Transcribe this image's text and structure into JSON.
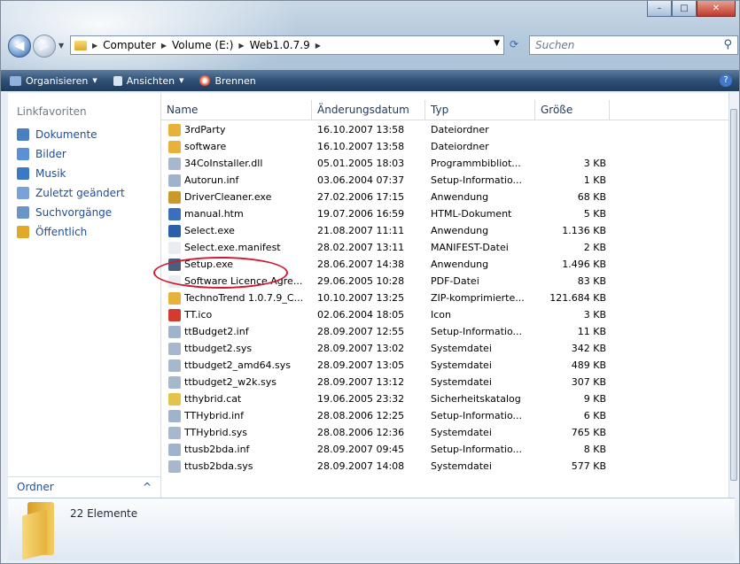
{
  "window": {
    "minimize": "–",
    "maximize": "□",
    "close": "✕"
  },
  "address": {
    "crumbs": [
      "Computer",
      "Volume (E:)",
      "Web1.0.7.9"
    ],
    "search_placeholder": "Suchen"
  },
  "toolbar": {
    "organize": "Organisieren",
    "views": "Ansichten",
    "burn": "Brennen"
  },
  "sidebar": {
    "heading": "Linkfavoriten",
    "items": [
      {
        "label": "Dokumente",
        "color": "#4a7fc1"
      },
      {
        "label": "Bilder",
        "color": "#5b8fd6"
      },
      {
        "label": "Musik",
        "color": "#3c78c4"
      },
      {
        "label": "Zuletzt geändert",
        "color": "#7aa2d9"
      },
      {
        "label": "Suchvorgänge",
        "color": "#6b95c7"
      },
      {
        "label": "Öffentlich",
        "color": "#e0a92a"
      }
    ],
    "folders_label": "Ordner",
    "folders_chevron": "^"
  },
  "columns": {
    "name": "Name",
    "date": "Änderungsdatum",
    "type": "Typ",
    "size": "Größe"
  },
  "files": [
    {
      "name": "3rdParty",
      "date": "16.10.2007 13:58",
      "type": "Dateiordner",
      "size": "",
      "color": "#e8b23a"
    },
    {
      "name": "software",
      "date": "16.10.2007 13:58",
      "type": "Dateiordner",
      "size": "",
      "color": "#e8b23a"
    },
    {
      "name": "34CoInstaller.dll",
      "date": "05.01.2005 18:03",
      "type": "Programmbibliot...",
      "size": "3 KB",
      "color": "#a7b8cc"
    },
    {
      "name": "Autorun.inf",
      "date": "03.06.2004 07:37",
      "type": "Setup-Informatio...",
      "size": "1 KB",
      "color": "#9fb4cc"
    },
    {
      "name": "DriverCleaner.exe",
      "date": "27.02.2006 17:15",
      "type": "Anwendung",
      "size": "68 KB",
      "color": "#c79a2a"
    },
    {
      "name": "manual.htm",
      "date": "19.07.2006 16:59",
      "type": "HTML-Dokument",
      "size": "5 KB",
      "color": "#3a6fc0"
    },
    {
      "name": "Select.exe",
      "date": "21.08.2007 11:11",
      "type": "Anwendung",
      "size": "1.136 KB",
      "color": "#2d5fa8"
    },
    {
      "name": "Select.exe.manifest",
      "date": "28.02.2007 13:11",
      "type": "MANIFEST-Datei",
      "size": "2 KB",
      "color": "#e9edf2"
    },
    {
      "name": "Setup.exe",
      "date": "28.06.2007 14:38",
      "type": "Anwendung",
      "size": "1.496 KB",
      "color": "#4a5f7c"
    },
    {
      "name": "Software Licence Agre...",
      "date": "29.06.2005 10:28",
      "type": "PDF-Datei",
      "size": "83 KB",
      "color": "#e9edf2"
    },
    {
      "name": "TechnoTrend 1.0.7.9_C...",
      "date": "10.10.2007 13:25",
      "type": "ZIP-komprimierte...",
      "size": "121.684 KB",
      "color": "#e6b23b"
    },
    {
      "name": "TT.ico",
      "date": "02.06.2004 18:05",
      "type": "Icon",
      "size": "3 KB",
      "color": "#d33b2c"
    },
    {
      "name": "ttBudget2.inf",
      "date": "28.09.2007 12:55",
      "type": "Setup-Informatio...",
      "size": "11 KB",
      "color": "#9fb4cc"
    },
    {
      "name": "ttbudget2.sys",
      "date": "28.09.2007 13:02",
      "type": "Systemdatei",
      "size": "342 KB",
      "color": "#a7b8cc"
    },
    {
      "name": "ttbudget2_amd64.sys",
      "date": "28.09.2007 13:05",
      "type": "Systemdatei",
      "size": "489 KB",
      "color": "#a7b8cc"
    },
    {
      "name": "ttbudget2_w2k.sys",
      "date": "28.09.2007 13:12",
      "type": "Systemdatei",
      "size": "307 KB",
      "color": "#a7b8cc"
    },
    {
      "name": "tthybrid.cat",
      "date": "19.06.2005 23:32",
      "type": "Sicherheitskatalog",
      "size": "9 KB",
      "color": "#e3c34a"
    },
    {
      "name": "TTHybrid.inf",
      "date": "28.08.2006 12:25",
      "type": "Setup-Informatio...",
      "size": "6 KB",
      "color": "#9fb4cc"
    },
    {
      "name": "TTHybrid.sys",
      "date": "28.08.2006 12:36",
      "type": "Systemdatei",
      "size": "765 KB",
      "color": "#a7b8cc"
    },
    {
      "name": "ttusb2bda.inf",
      "date": "28.09.2007 09:45",
      "type": "Setup-Informatio...",
      "size": "8 KB",
      "color": "#9fb4cc"
    },
    {
      "name": "ttusb2bda.sys",
      "date": "28.09.2007 14:08",
      "type": "Systemdatei",
      "size": "577 KB",
      "color": "#a7b8cc"
    }
  ],
  "details": {
    "count": "22 Elemente"
  }
}
